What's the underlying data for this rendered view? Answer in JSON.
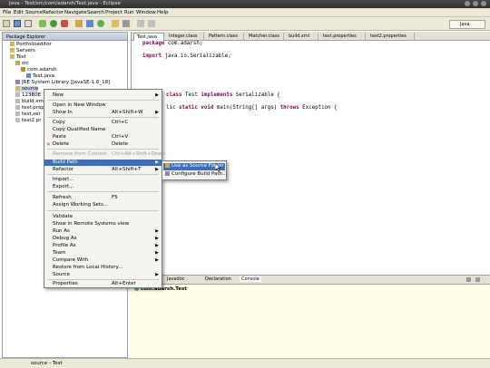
{
  "window": {
    "title": "Java - Test/src/com/adarsh/Test.java - Eclipse"
  },
  "menubar": [
    "File",
    "Edit",
    "Source",
    "Refactor",
    "Navigate",
    "Search",
    "Project",
    "Run",
    "Window",
    "Help"
  ],
  "perspective": "Java",
  "explorer": {
    "title": "Package Explorer",
    "items": [
      "Portfolioeditor",
      "Servers",
      "Test",
      "src",
      "com.adarsh",
      "Test.java",
      "JRE System Library [JavaSE-1.6_18]",
      "source",
      "123B0E",
      "build.xml",
      "test.prop",
      "test.ser",
      "test2.pr"
    ]
  },
  "editor": {
    "tabs": [
      "Test.java",
      "Integer.class",
      "Pattern.class",
      "Matcher.class",
      "build.xml",
      "test.properties",
      "test2.properties"
    ],
    "line1_kw": "package",
    "line1_rest": " com.adarsh;",
    "line2_kw": "import",
    "line2_rest": " java.io.Serializable;",
    "line3_kw1": "class",
    "line3_mid": " Test ",
    "line3_kw2": "implements",
    "line3_rest": " Serializable {",
    "line4_pre": "lic ",
    "line4_kw1": "static",
    "line4_kw2": "void",
    "line4_mid": " main(String[] args) ",
    "line4_kw3": "throws",
    "line4_rest": " Exception {"
  },
  "bottom": {
    "tabs": [
      "Javadoc",
      "Declaration",
      "Console"
    ],
    "content": "com.adarsh.Test"
  },
  "status": {
    "text": "source - Test"
  },
  "context_menu": {
    "new": "New",
    "open_new_window": "Open in New Window",
    "show_in": "Show In",
    "show_in_acc": "Alt+Shift+W",
    "copy": "Copy",
    "copy_acc": "Ctrl+C",
    "copy_qualified": "Copy Qualified Name",
    "paste": "Paste",
    "paste_acc": "Ctrl+V",
    "delete": "Delete",
    "delete_acc": "Delete",
    "remove_context": "Remove from Context",
    "remove_context_acc": "Ctrl+Alt+Shift+Down",
    "build_path": "Build Path",
    "refactor": "Refactor",
    "refactor_acc": "Alt+Shift+T",
    "import": "Import...",
    "export": "Export...",
    "refresh": "Refresh",
    "refresh_acc": "F5",
    "assign_working_sets": "Assign Working Sets...",
    "validate": "Validate",
    "show_remote": "Show in Remote Systems view",
    "run_as": "Run As",
    "debug_as": "Debug As",
    "profile_as": "Profile As",
    "team": "Team",
    "compare_with": "Compare With",
    "restore_history": "Restore from Local History...",
    "source": "Source",
    "properties": "Properties",
    "properties_acc": "Alt+Enter"
  },
  "submenu": {
    "use_as_source": "Use as Source Folder",
    "configure": "Configure Build Path..."
  },
  "colors": {
    "highlight": "#3b6fbf",
    "keyword": "#7f0055",
    "panel_bg": "#fffde6"
  }
}
